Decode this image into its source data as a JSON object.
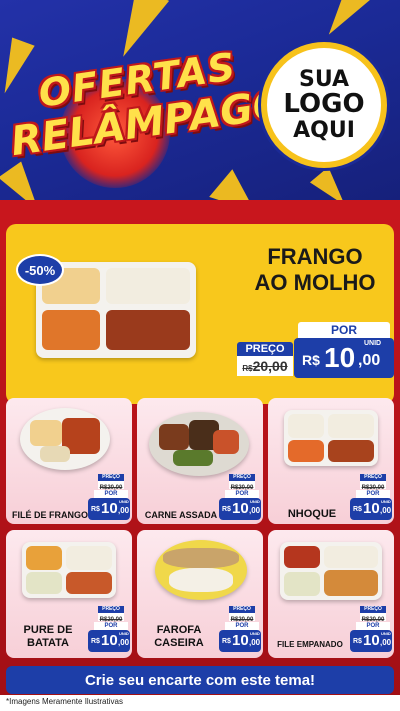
{
  "header": {
    "brand_line1": "OFERTAS",
    "brand_line2": "RELÂMPAGO",
    "logo_line1": "SUA",
    "logo_line2": "LOGO",
    "logo_line3": "AQUI"
  },
  "colors": {
    "header_blue": "#1b2a96",
    "accent_yellow": "#f7c21b",
    "banner_red": "#c8161d",
    "price_blue": "#1d3ea8"
  },
  "featured": {
    "discount": "-50%",
    "title_line1": "FRANGO",
    "title_line2": "AO MOLHO",
    "price_label": "PREÇO",
    "old_currency": "R$",
    "old_price": "20,00",
    "por_label": "POR",
    "currency": "R$",
    "new_price_int": "10",
    "new_price_dec": ",00",
    "unit": "UNID"
  },
  "products": [
    {
      "name": "FILÉ DE FRANGO",
      "price_label": "PREÇO",
      "old_price": "R$20,00",
      "por_label": "POR",
      "currency": "R$",
      "new_price_int": "10",
      "new_price_dec": ",00",
      "unit": "UNID"
    },
    {
      "name": "CARNE ASSADA",
      "price_label": "PREÇO",
      "old_price": "R$20,00",
      "por_label": "POR",
      "currency": "R$",
      "new_price_int": "10",
      "new_price_dec": ",00",
      "unit": "UNID"
    },
    {
      "name": "NHOQUE",
      "price_label": "PREÇO",
      "old_price": "R$20,00",
      "por_label": "POR",
      "currency": "R$",
      "new_price_int": "10",
      "new_price_dec": ",00",
      "unit": "UNID"
    },
    {
      "name_line1": "PURE DE",
      "name_line2": "BATATA",
      "price_label": "PREÇO",
      "old_price": "R$20,00",
      "por_label": "POR",
      "currency": "R$",
      "new_price_int": "10",
      "new_price_dec": ",00",
      "unit": "UNID"
    },
    {
      "name_line1": "FAROFA",
      "name_line2": "CASEIRA",
      "price_label": "PREÇO",
      "old_price": "R$20,00",
      "por_label": "POR",
      "currency": "R$",
      "new_price_int": "10",
      "new_price_dec": ",00",
      "unit": "UNID"
    },
    {
      "name": "FILE EMPANADO",
      "price_label": "PREÇO",
      "old_price": "R$20,00",
      "por_label": "POR",
      "currency": "R$",
      "new_price_int": "10",
      "new_price_dec": ",00",
      "unit": "UNID"
    }
  ],
  "footer": {
    "cta": "Crie seu encarte com este tema!",
    "disclaimer": "*Imagens Meramente Ilustrativas"
  }
}
